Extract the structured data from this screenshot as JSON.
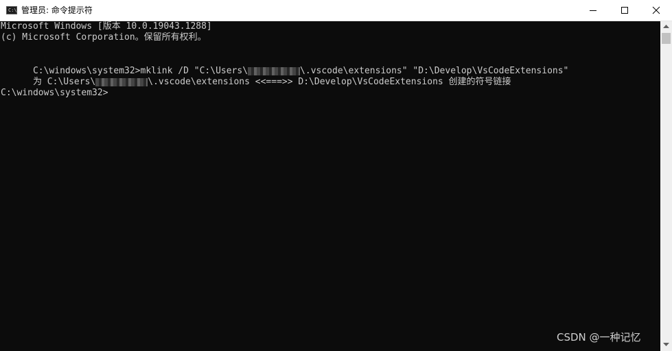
{
  "window": {
    "title": "管理员: 命令提示符",
    "icon": "cmd-icon",
    "icon_glyph": "C:\\",
    "controls": [
      "minimize-icon",
      "maximize-icon",
      "close-icon"
    ]
  },
  "console": {
    "lines": [
      "Microsoft Windows [版本 10.0.19043.1288]",
      "(c) Microsoft Corporation。保留所有权利。",
      "",
      "",
      "",
      ""
    ],
    "line3_before": "C:\\windows\\system32>mklink /D \"C:\\Users\\",
    "line3_after": "\\.vscode\\extensions\" \"D:\\Develop\\VsCodeExtensions\"",
    "line4_before": "为 C:\\Users\\",
    "line4_after": "\\.vscode\\extensions <<===>> D:\\Develop\\VsCodeExtensions 创建的符号链接",
    "prompt": "C:\\windows\\system32>"
  },
  "watermark": "CSDN @一种记忆",
  "colors": {
    "console_bg": "#0c0c0c",
    "console_text": "#cccccc",
    "titlebar_bg": "#ffffff"
  }
}
